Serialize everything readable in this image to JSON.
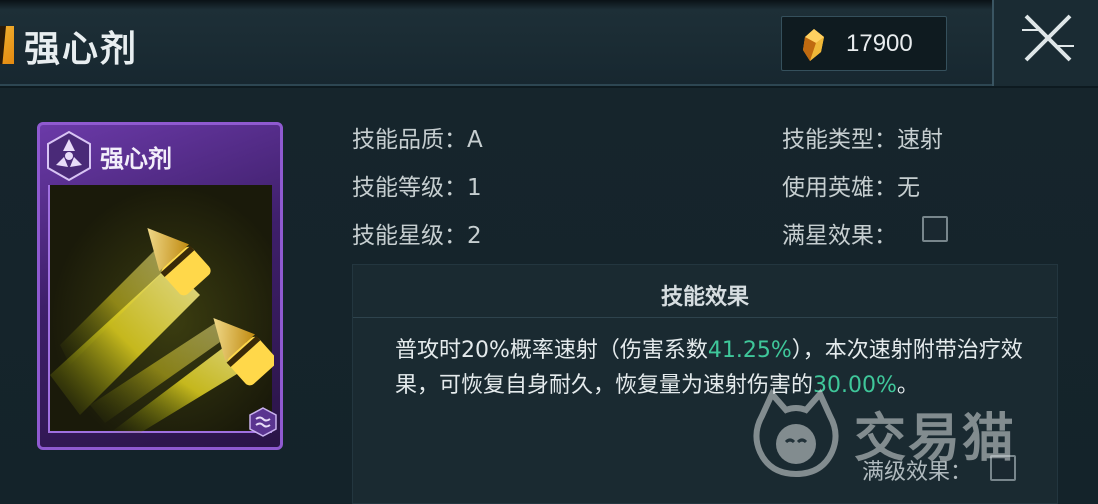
{
  "header": {
    "title": "强心剂",
    "currency_value": "17900",
    "currency_icon": "crystal-icon",
    "close_icon": "close-icon"
  },
  "card": {
    "name": "强心剂",
    "emblem_icon": "hexagon-emblem-icon",
    "art": "twin-yellow-bullets-art",
    "corner_icon": "wave-badge-icon",
    "border_color": "#8f5ad0"
  },
  "attributes": {
    "quality_label": "技能品质：",
    "quality_value": "A",
    "level_label": "技能等级：",
    "level_value": "1",
    "star_label": "技能星级：",
    "star_value": "2",
    "type_label": "技能类型：",
    "type_value": "速射",
    "hero_label": "使用英雄：",
    "hero_value": "无",
    "fullstar_label": "满星效果："
  },
  "effect": {
    "title": "技能效果",
    "text_1": "普攻时20%概率速射（伤害系数",
    "highlight_1": "41.25%",
    "text_2": "），本次速射附带治疗效果，可恢复自身耐久，恢复量为速射伤害的",
    "highlight_2": "30.00%",
    "text_3": "。",
    "highlight_color": "#3fc79a"
  },
  "footer": {
    "fulllevel_label": "满级效果："
  },
  "watermark": {
    "text": "交易猫"
  }
}
